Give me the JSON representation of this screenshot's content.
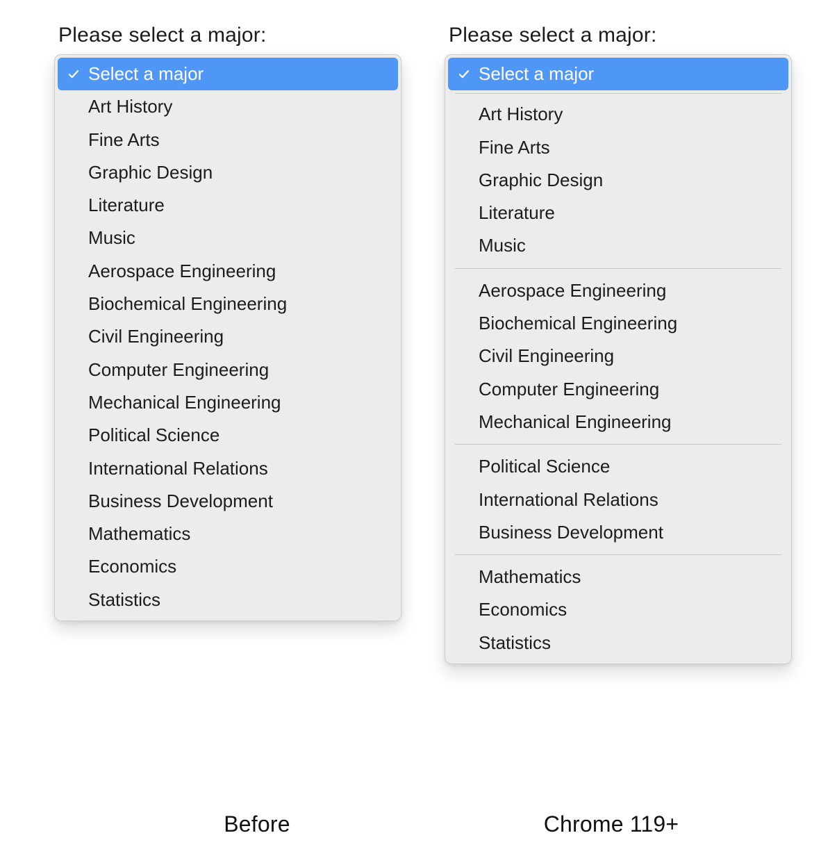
{
  "labels": {
    "prompt": "Please select a major:",
    "caption_before": "Before",
    "caption_after": "Chrome 119+"
  },
  "option_selected": "Select a major",
  "before": {
    "items": [
      "Art History",
      "Fine Arts",
      "Graphic Design",
      "Literature",
      "Music",
      "Aerospace Engineering",
      "Biochemical Engineering",
      "Civil Engineering",
      "Computer Engineering",
      "Mechanical Engineering",
      "Political Science",
      "International Relations",
      "Business Development",
      "Mathematics",
      "Economics",
      "Statistics"
    ]
  },
  "after": {
    "groups": [
      [
        "Art History",
        "Fine Arts",
        "Graphic Design",
        "Literature",
        "Music"
      ],
      [
        "Aerospace Engineering",
        "Biochemical Engineering",
        "Civil Engineering",
        "Computer Engineering",
        "Mechanical Engineering"
      ],
      [
        "Political Science",
        "International Relations",
        "Business Development"
      ],
      [
        "Mathematics",
        "Economics",
        "Statistics"
      ]
    ]
  },
  "colors": {
    "highlight": "#4f97f7",
    "panel": "#ececec"
  }
}
